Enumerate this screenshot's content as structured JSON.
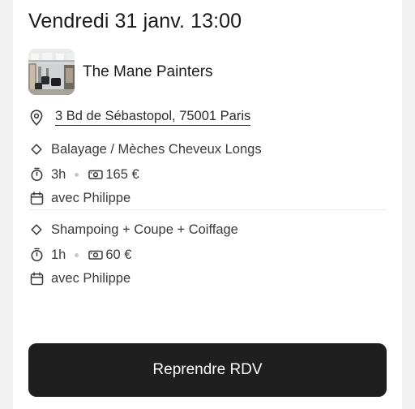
{
  "appointment": {
    "datetime": "Vendredi 31 janv. 13:00",
    "salon_name": "The Mane Painters",
    "address": "3 Bd de Sébastopol, 75001 Paris"
  },
  "services": [
    {
      "name": "Balayage / Mèches Cheveux Longs",
      "duration": "3h",
      "price": "165 €",
      "staff": "avec Philippe"
    },
    {
      "name": "Shampoing + Coupe + Coiffage",
      "duration": "1h",
      "price": "60 €",
      "staff": "avec Philippe"
    }
  ],
  "cta": {
    "label": "Reprendre RDV"
  },
  "icons": {
    "location": "map-pin-icon",
    "service": "diamond-icon",
    "duration": "stopwatch-icon",
    "price": "cash-icon",
    "staff": "calendar-icon"
  },
  "colors": {
    "button_bg": "#1f1f1f",
    "button_text": "#ffffff",
    "page_bg": "#f2f2f3",
    "card_bg": "#ffffff"
  }
}
